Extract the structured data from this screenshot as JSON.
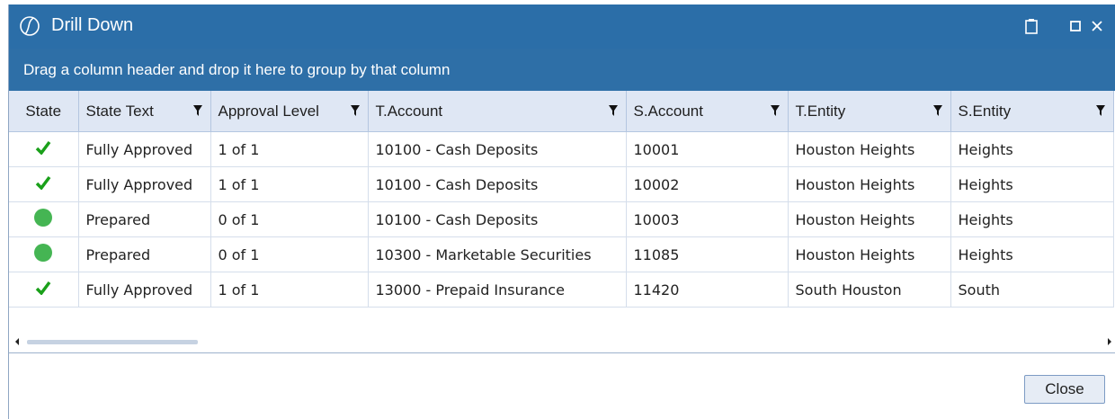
{
  "window": {
    "title": "Drill Down",
    "titlebar_color": "#2b6ea8"
  },
  "group_panel": {
    "text": "Drag a column header and drop it here to group by that column"
  },
  "columns": [
    "State",
    "State Text",
    "Approval Level",
    "T.Account",
    "S.Account",
    "T.Entity",
    "S.Entity"
  ],
  "rows": [
    {
      "state": "fully-approved",
      "state_text": "Fully Approved",
      "approval_level": "1 of 1",
      "t_account": "10100 - Cash Deposits",
      "s_account": "10001",
      "t_entity": "Houston Heights",
      "s_entity": "Heights"
    },
    {
      "state": "fully-approved",
      "state_text": "Fully Approved",
      "approval_level": "1 of 1",
      "t_account": "10100 - Cash Deposits",
      "s_account": "10002",
      "t_entity": "Houston Heights",
      "s_entity": "Heights"
    },
    {
      "state": "prepared",
      "state_text": "Prepared",
      "approval_level": "0 of 1",
      "t_account": "10100 - Cash Deposits",
      "s_account": "10003",
      "t_entity": "Houston Heights",
      "s_entity": "Heights"
    },
    {
      "state": "prepared",
      "state_text": "Prepared",
      "approval_level": "0 of 1",
      "t_account": "10300 - Marketable Securities",
      "s_account": "11085",
      "t_entity": "Houston Heights",
      "s_entity": "Heights"
    },
    {
      "state": "fully-approved",
      "state_text": "Fully Approved",
      "approval_level": "1 of 1",
      "t_account": "13000 - Prepaid Insurance",
      "s_account": "11420",
      "t_entity": "South Houston",
      "s_entity": "South"
    }
  ],
  "status_colors": {
    "approved_check": "#1aa01a",
    "prepared_circle": "#45b553"
  },
  "footer": {
    "close_label": "Close"
  }
}
